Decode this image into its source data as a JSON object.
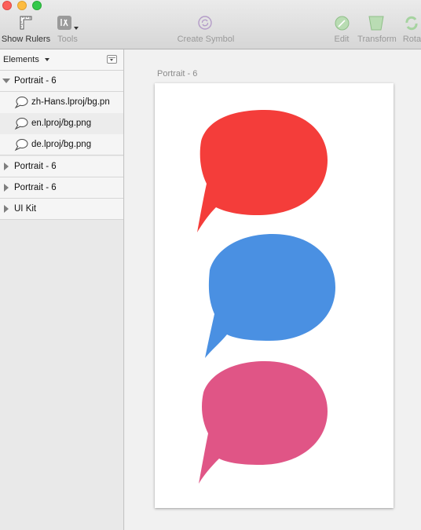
{
  "window": {
    "controls": [
      "close",
      "minimize",
      "maximize"
    ]
  },
  "toolbar": {
    "show_rulers": {
      "label": "Show Rulers",
      "icon": "ruler-icon",
      "enabled": true
    },
    "tools": {
      "label": "Tools",
      "icon": "tools-icon",
      "enabled": false
    },
    "create_symbol": {
      "label": "Create Symbol",
      "icon": "symbol-icon",
      "enabled": false
    },
    "edit": {
      "label": "Edit",
      "icon": "edit-icon",
      "enabled": false
    },
    "transform": {
      "label": "Transform",
      "icon": "transform-icon",
      "enabled": false
    },
    "rotate": {
      "label": "Rotat",
      "icon": "rotate-icon",
      "enabled": false
    }
  },
  "sidebar": {
    "title": "Elements",
    "groups": [
      {
        "label": "Portrait - 6",
        "expanded": true,
        "children": [
          {
            "label": "zh-Hans.lproj/bg.pn",
            "icon": "speech-bubble-icon"
          },
          {
            "label": "en.lproj/bg.png",
            "icon": "speech-bubble-icon"
          },
          {
            "label": "de.lproj/bg.png",
            "icon": "speech-bubble-icon"
          }
        ]
      },
      {
        "label": "Portrait - 6",
        "expanded": false
      },
      {
        "label": "Portrait - 6",
        "expanded": false
      },
      {
        "label": "UI Kit",
        "expanded": false
      }
    ]
  },
  "canvas": {
    "artboard_title": "Portrait - 6",
    "bubbles": [
      {
        "name": "red-speech-bubble",
        "color": "#f43d3a"
      },
      {
        "name": "blue-speech-bubble",
        "color": "#4a90e2"
      },
      {
        "name": "pink-speech-bubble",
        "color": "#e05586"
      }
    ]
  },
  "colors": {
    "toolbar_top": "#ebebeb",
    "toolbar_bottom": "#d6d6d6",
    "sidebar": "#e9e9e9",
    "canvas": "#f1f1f1",
    "artboard": "#ffffff"
  }
}
